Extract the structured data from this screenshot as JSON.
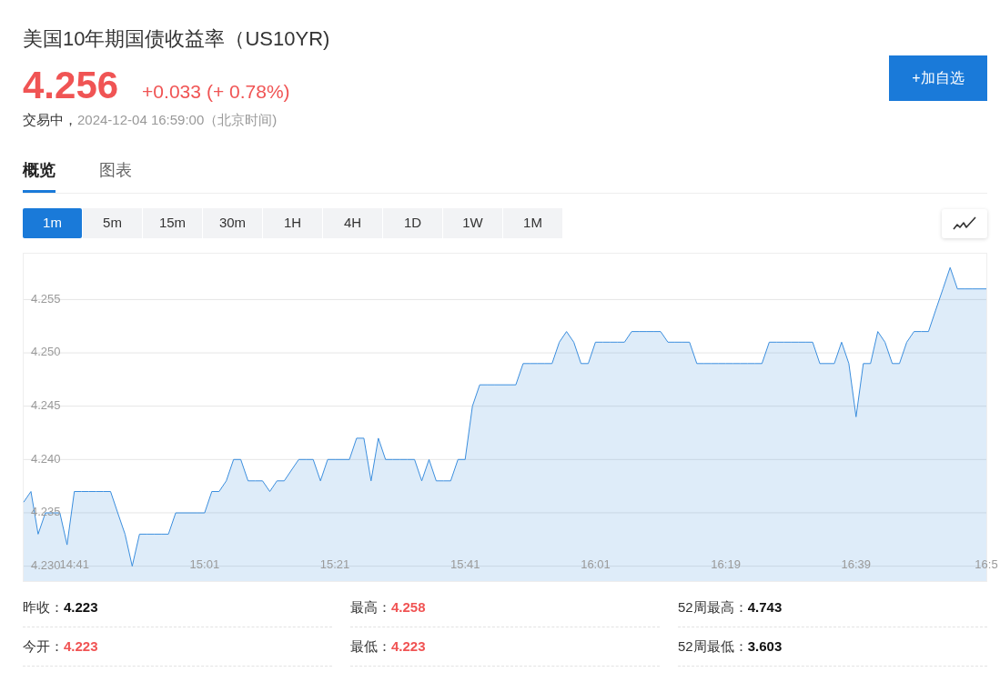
{
  "header": {
    "title": "美国10年期国债收益率（US10YR)",
    "rising": true,
    "price": "4.256",
    "change": "+0.033",
    "change_percent": "(+ 0.78%)",
    "status": "交易中，",
    "timestamp": "2024-12-04 16:59:00（北京时间)",
    "watch_button": "+加自选"
  },
  "tabs": [
    {
      "label": "概览",
      "selected": true
    },
    {
      "label": "图表",
      "selected": false
    }
  ],
  "intervals": [
    {
      "label": "1m",
      "selected": true
    },
    {
      "label": "5m",
      "selected": false
    },
    {
      "label": "15m",
      "selected": false
    },
    {
      "label": "30m",
      "selected": false
    },
    {
      "label": "1H",
      "selected": false
    },
    {
      "label": "4H",
      "selected": false
    },
    {
      "label": "1D",
      "selected": false
    },
    {
      "label": "1W",
      "selected": false
    },
    {
      "label": "1M",
      "selected": false
    }
  ],
  "chart": {
    "chart_data": {
      "type": "area",
      "grid": true,
      "ylim": [
        4.2286,
        4.2593
      ],
      "yticks": [
        {
          "value": 4.255,
          "label": "4.255"
        },
        {
          "value": 4.25,
          "label": "4.250"
        },
        {
          "value": 4.245,
          "label": "4.245"
        },
        {
          "value": 4.24,
          "label": "4.240"
        },
        {
          "value": 4.235,
          "label": "4.235"
        },
        {
          "value": 4.23,
          "label": "4.230"
        }
      ],
      "categories": [
        null,
        null,
        null,
        null,
        null,
        null,
        null,
        "14:41",
        null,
        null,
        null,
        null,
        null,
        null,
        null,
        null,
        null,
        null,
        null,
        null,
        null,
        null,
        null,
        null,
        null,
        "15:01",
        null,
        null,
        null,
        null,
        null,
        null,
        null,
        null,
        null,
        null,
        null,
        null,
        null,
        null,
        null,
        null,
        null,
        "15:21",
        null,
        null,
        null,
        null,
        null,
        null,
        null,
        null,
        null,
        null,
        null,
        null,
        null,
        null,
        null,
        null,
        null,
        "15:41",
        null,
        null,
        null,
        null,
        null,
        null,
        null,
        null,
        null,
        null,
        null,
        null,
        null,
        null,
        null,
        null,
        null,
        "16:01",
        null,
        null,
        null,
        null,
        null,
        null,
        null,
        null,
        null,
        null,
        null,
        null,
        null,
        null,
        null,
        null,
        null,
        "16:19",
        null,
        null,
        null,
        null,
        null,
        null,
        null,
        null,
        null,
        null,
        null,
        null,
        null,
        null,
        null,
        null,
        null,
        "16:39",
        null,
        null,
        null,
        null,
        null,
        null,
        null,
        null,
        null,
        null,
        null,
        null,
        null,
        null,
        null,
        null,
        null,
        "16:5"
      ],
      "series": [
        {
          "color": "#3b8ede",
          "values": [
            4.236,
            4.237,
            4.233,
            4.235,
            4.235,
            4.235,
            4.232,
            4.237,
            4.237,
            4.237,
            4.237,
            4.237,
            4.237,
            4.235,
            4.233,
            4.23,
            4.233,
            4.233,
            4.233,
            4.233,
            4.233,
            4.235,
            4.235,
            4.235,
            4.235,
            4.235,
            4.237,
            4.237,
            4.238,
            4.24,
            4.24,
            4.238,
            4.238,
            4.238,
            4.237,
            4.238,
            4.238,
            4.239,
            4.24,
            4.24,
            4.24,
            4.238,
            4.24,
            4.24,
            4.24,
            4.24,
            4.242,
            4.242,
            4.238,
            4.242,
            4.24,
            4.24,
            4.24,
            4.24,
            4.24,
            4.238,
            4.24,
            4.238,
            4.238,
            4.238,
            4.24,
            4.24,
            4.245,
            4.247,
            4.247,
            4.247,
            4.247,
            4.247,
            4.247,
            4.249,
            4.249,
            4.249,
            4.249,
            4.249,
            4.251,
            4.252,
            4.251,
            4.249,
            4.249,
            4.251,
            4.251,
            4.251,
            4.251,
            4.251,
            4.252,
            4.252,
            4.252,
            4.252,
            4.252,
            4.251,
            4.251,
            4.251,
            4.251,
            4.249,
            4.249,
            4.249,
            4.249,
            4.249,
            4.249,
            4.249,
            4.249,
            4.249,
            4.249,
            4.251,
            4.251,
            4.251,
            4.251,
            4.251,
            4.251,
            4.251,
            4.249,
            4.249,
            4.249,
            4.251,
            4.249,
            4.244,
            4.249,
            4.249,
            4.252,
            4.251,
            4.249,
            4.249,
            4.251,
            4.252,
            4.252,
            4.252,
            4.254,
            4.256,
            4.258,
            4.256,
            4.256,
            4.256,
            4.256,
            4.256
          ]
        }
      ]
    }
  },
  "stats": [
    {
      "label": "昨收：",
      "value": "4.223",
      "color": "#111111"
    },
    {
      "label": "最高：",
      "value": "4.258",
      "color": "#f05454"
    },
    {
      "label": "52周最高：",
      "value": "4.743",
      "color": "#111111"
    },
    {
      "label": "今开：",
      "value": "4.223",
      "color": "#f05454"
    },
    {
      "label": "最低：",
      "value": "4.223",
      "color": "#f05454"
    },
    {
      "label": "52周最低：",
      "value": "3.603",
      "color": "#111111"
    }
  ]
}
